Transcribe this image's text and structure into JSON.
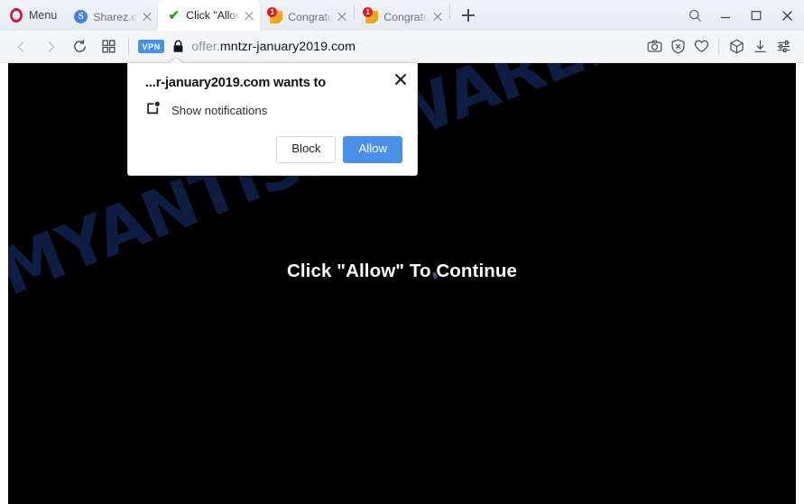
{
  "browser": {
    "menu_label": "Menu",
    "logo_icon": "opera-logo-icon",
    "tabs": [
      {
        "title": "Sharez.cc - ",
        "favicon": "sharez-s-icon",
        "badge": "",
        "active": false
      },
      {
        "title": "Click \"Allow\" To Continue",
        "favicon": "green-check-icon",
        "badge": "",
        "active": true
      },
      {
        "title": "Congratulations",
        "favicon": "notification-page-icon",
        "badge": "1",
        "active": false
      },
      {
        "title": "Congratulations",
        "favicon": "notification-page-icon",
        "badge": "1",
        "active": false
      }
    ],
    "new_tab_label": "+",
    "window_controls": {
      "search": "search-icon",
      "minimize": "minimize-icon",
      "maximize": "maximize-icon",
      "close": "close-icon"
    }
  },
  "toolbar": {
    "back": "back-arrow-icon",
    "forward": "forward-arrow-icon",
    "reload": "reload-icon",
    "speed_dial": "speed-dial-grid-icon",
    "vpn_label": "VPN",
    "lock": "padlock-icon",
    "url_prefix": "offer.",
    "url_domain": "mntzr-january2019.com",
    "url_full": "offer.mntzr-january2019.com",
    "right_icons": [
      "snapshot-camera-icon",
      "ad-blocker-shield-icon",
      "heart-favorites-icon",
      "extensions-cube-icon",
      "downloads-icon",
      "easy-setup-sliders-icon"
    ]
  },
  "page": {
    "background_color": "#000000",
    "headline": "Click \"Allow\" To Continue",
    "watermark_text": "MYANTISPYWARE.COM",
    "watermark_color": "#0e1e42"
  },
  "permission_dialog": {
    "title": "...r-january2019.com wants to",
    "permission_icon": "notification-permission-icon",
    "permission_label": "Show notifications",
    "block_label": "Block",
    "allow_label": "Allow",
    "close_icon": "dialog-close-icon",
    "allow_color": "#4a90e8"
  }
}
